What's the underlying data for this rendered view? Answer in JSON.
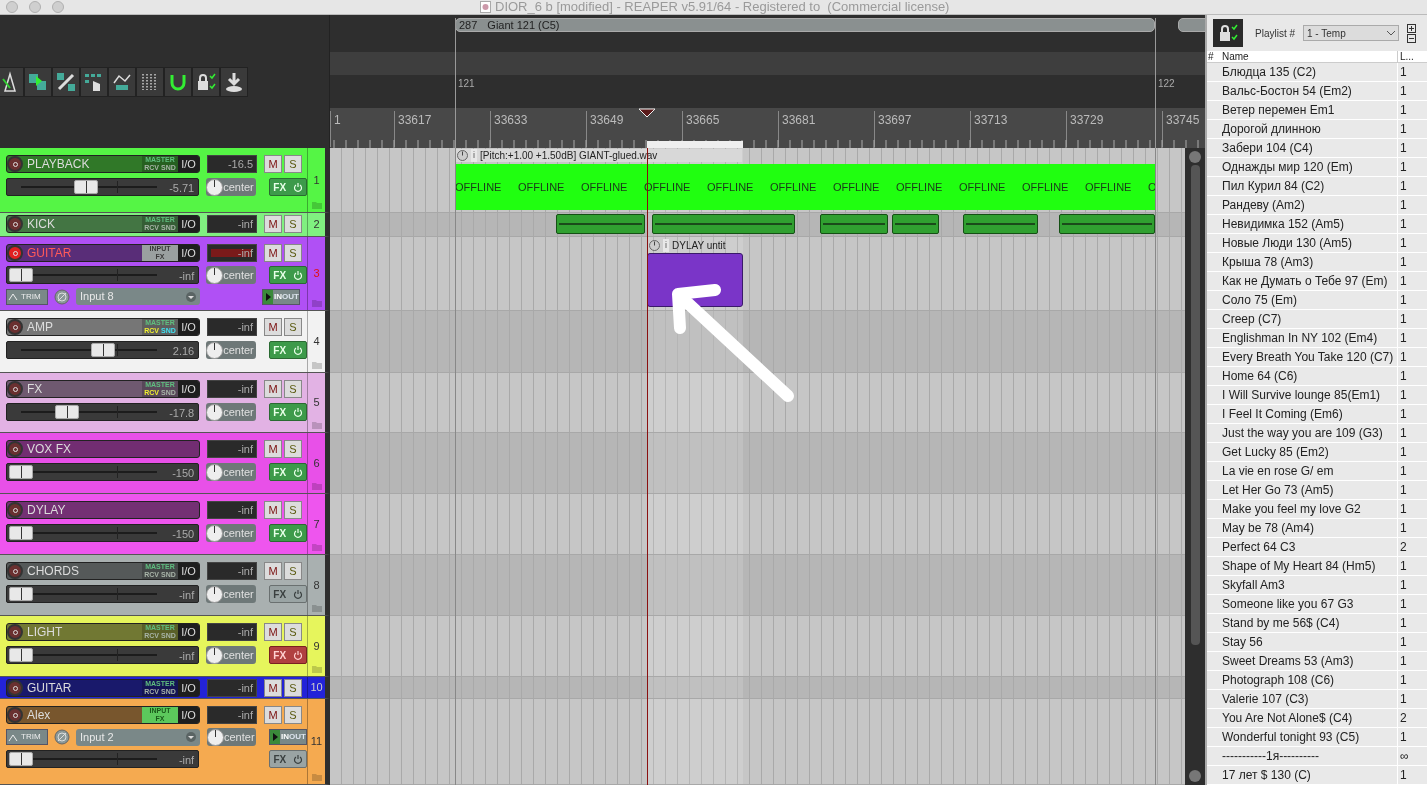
{
  "window": {
    "title": "DIOR_6 b [modified] - REAPER v5.91/64 - Registered to  (Commercial license)"
  },
  "arrange": {
    "region": {
      "number": "287",
      "name": "Giant 121 (C5)"
    },
    "markers": [
      "121",
      "122"
    ],
    "ruler": [
      "1",
      "33617",
      "33633",
      "33649",
      "33665",
      "33681",
      "33697",
      "33713",
      "33729",
      "33745"
    ]
  },
  "tracks": [
    {
      "number": "1",
      "name": "PLAYBACK",
      "color": "#55f545",
      "kind": "normal",
      "armed": false,
      "routing": {
        "kind": "master",
        "top": "MASTER",
        "rcv": "RCV",
        "snd": "SND",
        "rcv_on": false,
        "snd_on": false
      },
      "io": "I/O",
      "meter": "-16.5",
      "mute": "M",
      "solo": "S",
      "volume": "-5.71",
      "level": 0.48,
      "pan": "center",
      "fx_label": "FX",
      "fx_enabled": true,
      "fx_bypassed": false,
      "item": {
        "kind": "offline",
        "info": "i",
        "title": "[Pitch:+1.00 +1.50dB] GIANT-glued.wav",
        "labels": [
          "OFFLINE",
          "OFFLINE",
          "OFFLINE",
          "OFFLINE",
          "OFFLINE",
          "OFFLINE",
          "OFFLINE",
          "OFFLINE",
          "OFFLINE",
          "OFFLINE",
          "OFFLINE",
          "O"
        ]
      }
    },
    {
      "number": "2",
      "name": "KICK",
      "color": "#80f080",
      "kind": "compact",
      "armed": false,
      "routing": {
        "kind": "master",
        "top": "MASTER",
        "rcv": "RCV",
        "snd": "SND",
        "rcv_on": false,
        "snd_on": false
      },
      "io": "I/O",
      "meter": "-inf",
      "mute": "M",
      "solo": "S",
      "item": {
        "kind": "blocks"
      }
    },
    {
      "number": "3",
      "name": "GUITAR",
      "color": "#b050f5",
      "kind": "record",
      "armed": true,
      "routing": {
        "kind": "input_fx",
        "top": "INPUT",
        "bottom": "FX",
        "on": false
      },
      "io": "I/O",
      "meter": "-inf",
      "mute": "M",
      "solo": "S",
      "volume": "-inf",
      "level": 0,
      "pan": "center",
      "fx_label": "FX",
      "fx_enabled": true,
      "fx_bypassed": false,
      "trim": "TRIM",
      "input": "Input 8",
      "monitor": [
        "IN",
        "OUT"
      ],
      "item": {
        "kind": "midi",
        "info": "i",
        "title": "DYLAY untit"
      }
    },
    {
      "number": "4",
      "name": "AMP",
      "color": "#f2f2f2",
      "kind": "normal",
      "armed": false,
      "routing": {
        "kind": "master",
        "top": "MASTER",
        "rcv": "RCV",
        "snd": "SND",
        "rcv_on": true,
        "snd_on": true
      },
      "io": "I/O",
      "meter": "-inf",
      "mute": "M",
      "solo": "S",
      "volume": "2.16",
      "level": 0.6,
      "pan": "center",
      "fx_label": "FX",
      "fx_enabled": true,
      "fx_bypassed": false
    },
    {
      "number": "5",
      "name": "FX",
      "color": "#e2b2e4",
      "kind": "normal",
      "armed": false,
      "routing": {
        "kind": "master",
        "top": "MASTER",
        "rcv": "RCV",
        "snd": "SND",
        "rcv_on": true,
        "snd_on": false
      },
      "io": "I/O",
      "meter": "-inf",
      "mute": "M",
      "solo": "S",
      "volume": "-17.8",
      "level": 0.34,
      "pan": "center",
      "fx_label": "FX",
      "fx_enabled": true,
      "fx_bypassed": false
    },
    {
      "number": "6",
      "name": "VOX FX",
      "color": "#e850e8",
      "kind": "normal",
      "armed": false,
      "meter": "-inf",
      "mute": "M",
      "solo": "S",
      "volume": "-150",
      "level": 0,
      "pan": "center",
      "fx_label": "FX",
      "fx_enabled": true,
      "fx_bypassed": false
    },
    {
      "number": "7",
      "name": "DYLAY",
      "color": "#ee55ee",
      "kind": "normal",
      "armed": false,
      "meter": "-inf",
      "mute": "M",
      "solo": "S",
      "volume": "-150",
      "level": 0,
      "pan": "center",
      "fx_label": "FX",
      "fx_enabled": true,
      "fx_bypassed": false
    },
    {
      "number": "8",
      "name": "CHORDS",
      "color": "#a9b0b0",
      "kind": "normal",
      "armed": false,
      "routing": {
        "kind": "master",
        "top": "MASTER",
        "rcv": "RCV",
        "snd": "SND",
        "rcv_on": false,
        "snd_on": false
      },
      "io": "I/O",
      "meter": "-inf",
      "mute": "M",
      "solo": "S",
      "volume": "-inf",
      "level": 0,
      "pan": "center",
      "fx_label": "FX",
      "fx_enabled": false,
      "fx_bypassed": false
    },
    {
      "number": "9",
      "name": "LIGHT",
      "color": "#e6f55c",
      "kind": "normal",
      "armed": false,
      "routing": {
        "kind": "master",
        "top": "MASTER",
        "rcv": "RCV",
        "snd": "SND",
        "rcv_on": false,
        "snd_on": false
      },
      "io": "I/O",
      "meter": "-inf",
      "mute": "M",
      "solo": "S",
      "volume": "-inf",
      "level": 0,
      "pan": "center",
      "fx_label": "FX",
      "fx_enabled": true,
      "fx_bypassed": true
    },
    {
      "number": "10",
      "name": "GUITAR",
      "color": "#2323d8",
      "kind": "compact",
      "armed": false,
      "routing": {
        "kind": "master",
        "top": "MASTER",
        "rcv": "RCV",
        "snd": "SND",
        "rcv_on": false,
        "snd_on": false
      },
      "io": "I/O",
      "meter": "-inf",
      "mute": "M",
      "solo": "S"
    },
    {
      "number": "11",
      "name": "Alex",
      "color": "#f5aa50",
      "kind": "record_alt",
      "armed": false,
      "routing": {
        "kind": "input_fx",
        "top": "INPUT",
        "bottom": "FX",
        "on": true
      },
      "io": "I/O",
      "meter": "-inf",
      "mute": "M",
      "solo": "S",
      "volume": "-inf",
      "level": 0,
      "pan": "center",
      "fx_label": "FX",
      "fx_enabled": false,
      "fx_bypassed": false,
      "trim": "TRIM",
      "input": "Input 2",
      "monitor": [
        "IN",
        "OUT"
      ]
    }
  ],
  "playlist": {
    "label": "Playlist #",
    "current": "1 - Temp",
    "columns": [
      "#",
      "Name",
      "L..."
    ],
    "rows": [
      {
        "name": "Блюдца 135 (C2)",
        "loops": "1"
      },
      {
        "name": "Вальс-Бостон 54 (Em2)",
        "loops": "1"
      },
      {
        "name": "Ветер перемен Em1",
        "loops": "1"
      },
      {
        "name": "Дорогой длинною",
        "loops": "1"
      },
      {
        "name": "Забери 104 (C4)",
        "loops": "1"
      },
      {
        "name": "Однажды мир 120 (Em)",
        "loops": "1"
      },
      {
        "name": "Пил Курил 84 (C2)",
        "loops": "1"
      },
      {
        "name": "Рандеву (Am2)",
        "loops": "1"
      },
      {
        "name": "Невидимка 152 (Am5)",
        "loops": "1"
      },
      {
        "name": "Новые Люди 130 (Am5)",
        "loops": "1"
      },
      {
        "name": "Крыша 78 (Am3)",
        "loops": "1"
      },
      {
        "name": "Как не Думать о Тебе 97 (Em)",
        "loops": "1"
      },
      {
        "name": "Соло 75 (Em)",
        "loops": "1"
      },
      {
        "name": "Creep (C7)",
        "loops": "1"
      },
      {
        "name": "Englishman In NY 102 (Em4)",
        "loops": "1"
      },
      {
        "name": "Every Breath You Take 120 (C7)",
        "loops": "1"
      },
      {
        "name": "Home 64 (C6)",
        "loops": "1"
      },
      {
        "name": "I Will Survive lounge 85(Em1)",
        "loops": "1"
      },
      {
        "name": "I Feel It Coming (Em6)",
        "loops": "1"
      },
      {
        "name": "Just the way you are 109 (G3)",
        "loops": "1"
      },
      {
        "name": "Get Lucky 85 (Em2)",
        "loops": "1"
      },
      {
        "name": "La vie en rose G/ em",
        "loops": "1"
      },
      {
        "name": "Let Her Go 73 (Am5)",
        "loops": "1"
      },
      {
        "name": "Make you feel my love G2",
        "loops": "1"
      },
      {
        "name": "May be 78 (Am4)",
        "loops": "1"
      },
      {
        "name": "Perfect 64 C3",
        "loops": "2"
      },
      {
        "name": "Shape of My Heart 84 (Hm5)",
        "loops": "1"
      },
      {
        "name": "Skyfall Am3",
        "loops": "1"
      },
      {
        "name": "Someone like you 67 G3",
        "loops": "1"
      },
      {
        "name": "Stand by me 56$ (C4)",
        "loops": "1"
      },
      {
        "name": "Stay 56",
        "loops": "1"
      },
      {
        "name": "Sweet Dreams 53 (Am3)",
        "loops": "1"
      },
      {
        "name": "Photograph 108 (C6)",
        "loops": "1"
      },
      {
        "name": "Valerie 107 (C3)",
        "loops": "1"
      },
      {
        "name": "You Are Not Alone$ (C4)",
        "loops": "2"
      },
      {
        "name": "Wonderful tonight 93 (C5)",
        "loops": "1"
      },
      {
        "name": "-----------1я----------",
        "loops": "∞"
      },
      {
        "name": "17 лет $ 130 (C)",
        "loops": "1"
      }
    ]
  }
}
